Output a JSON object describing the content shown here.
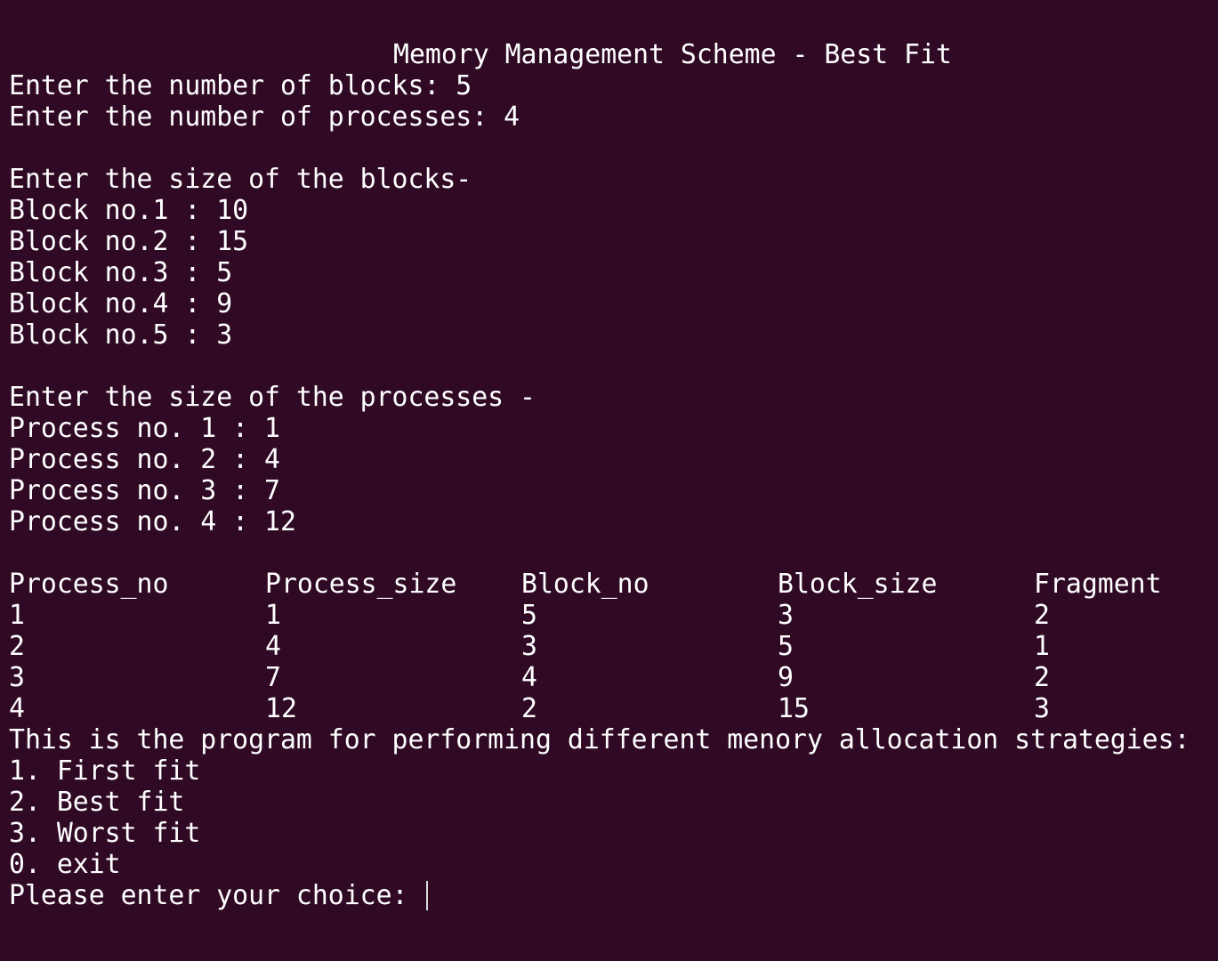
{
  "terminal": {
    "title": "Memory Management Scheme - Best Fit",
    "blocks_prompt": "Enter the number of blocks: 5",
    "processes_prompt": "Enter the number of processes: 4",
    "block_size_header": "Enter the size of the blocks-",
    "blocks": [
      "Block no.1 : 10",
      "Block no.2 : 15",
      "Block no.3 : 5",
      "Block no.4 : 9",
      "Block no.5 : 3"
    ],
    "process_size_header": "Enter the size of the processes -",
    "processes": [
      "Process no. 1 : 1",
      "Process no. 2 : 4",
      "Process no. 3 : 7",
      "Process no. 4 : 12"
    ],
    "table": {
      "headers": [
        "Process_no",
        "Process_size",
        "Block_no",
        "Block_size",
        "Fragment"
      ],
      "rows": [
        [
          "1",
          "1",
          "5",
          "3",
          "2"
        ],
        [
          "2",
          "4",
          "3",
          "5",
          "1"
        ],
        [
          "3",
          "7",
          "4",
          "9",
          "2"
        ],
        [
          "4",
          "12",
          "2",
          "15",
          "3"
        ]
      ]
    },
    "menu_intro": "This is the program for performing different menory allocation strategies:",
    "menu_items": [
      "1. First fit",
      "2. Best fit",
      "3. Worst fit",
      "0. exit"
    ],
    "choice_prompt": "Please enter your choice: "
  }
}
